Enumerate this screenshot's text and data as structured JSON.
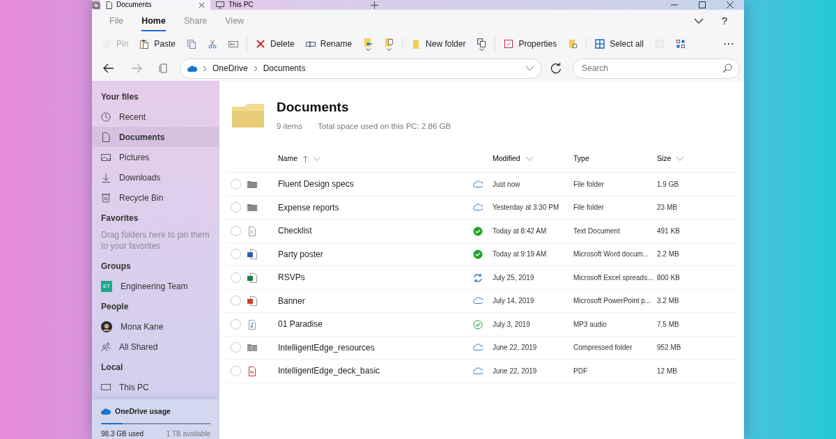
{
  "tabs": [
    {
      "label": "Documents",
      "selected": true,
      "closable": true
    },
    {
      "label": "This PC",
      "selected": false,
      "closable": false
    }
  ],
  "menu": [
    {
      "label": "File",
      "selected": false
    },
    {
      "label": "Home",
      "selected": true
    },
    {
      "label": "Share",
      "selected": false
    },
    {
      "label": "View",
      "selected": false
    }
  ],
  "toolbar": {
    "groups": [
      [
        {
          "label": "Pin",
          "disabled": true,
          "dropdown": false
        },
        {
          "label": "Paste",
          "disabled": false,
          "dropdown": false
        },
        {
          "disabled": false,
          "dropdown": false
        },
        {
          "disabled": false,
          "dropdown": false
        },
        {
          "disabled": false,
          "dropdown": false
        }
      ],
      [
        {
          "label": "Delete",
          "disabled": false,
          "dropdown": false
        },
        {
          "label": "Rename",
          "disabled": false,
          "dropdown": false
        },
        {
          "disabled": false,
          "dropdown": true
        },
        {
          "disabled": false,
          "dropdown": true
        }
      ],
      [
        {
          "label": "New folder",
          "disabled": false,
          "dropdown": false
        },
        {
          "disabled": false,
          "dropdown": true
        }
      ],
      [
        {
          "label": "Properties",
          "disabled": false,
          "dropdown": false
        },
        {
          "disabled": false,
          "dropdown": false
        }
      ],
      [
        {
          "label": "Select all",
          "disabled": false,
          "dropdown": false
        },
        {
          "disabled": true,
          "dropdown": false
        },
        {
          "disabled": false,
          "dropdown": false
        }
      ]
    ],
    "more": "⋯"
  },
  "help": "?",
  "address": {
    "breadcrumbs": [
      "OneDrive",
      "Documents"
    ],
    "search_placeholder": "Search"
  },
  "sidebar": {
    "sections": [
      {
        "title": "Your files",
        "items": [
          {
            "label": "Recent",
            "selected": false
          },
          {
            "label": "Documents",
            "selected": true
          },
          {
            "label": "Pictures",
            "selected": false
          },
          {
            "label": "Downloads",
            "selected": false
          },
          {
            "label": "Recycle Bin",
            "selected": false
          }
        ]
      },
      {
        "title": "Favorites",
        "hint": "Drag folders here to pin them to your favorites"
      },
      {
        "title": "Groups",
        "items": [
          {
            "label": "Engineering Team",
            "selected": false,
            "badge": "ET",
            "color": "#1aa88a"
          }
        ]
      },
      {
        "title": "People",
        "items": [
          {
            "label": "Mona Kane",
            "selected": false
          },
          {
            "label": "All Shared",
            "selected": false
          }
        ]
      },
      {
        "title": "Local",
        "items": [
          {
            "label": "This PC",
            "selected": false
          }
        ]
      }
    ],
    "usage": {
      "title": "OneDrive usage",
      "level": 0.2,
      "used": "98.3 GB used",
      "available": "1 TB available"
    }
  },
  "folder": {
    "title": "Documents",
    "count": "9 items",
    "space": "Total space used on this PC: 2.86 GB"
  },
  "table": {
    "columns": [
      {
        "label": "Name",
        "sorted": true
      },
      {
        "label": "Modified",
        "sorted": false
      },
      {
        "label": "Type",
        "sorted": false
      },
      {
        "label": "Size",
        "sorted": false
      }
    ],
    "rows": [
      {
        "name": "Fluent Design specs",
        "file_icon": {
          "kind": "folder"
        },
        "sync_status": {
          "kind": "cloud"
        },
        "modified": "Just now",
        "type": "File folder",
        "size": "1.9 GB",
        "selected": false
      },
      {
        "name": "Expense reports",
        "file_icon": {
          "kind": "folder"
        },
        "sync_status": {
          "kind": "cloud"
        },
        "modified": "Yesterday at 3:30 PM",
        "type": "File folder",
        "size": "23 MB",
        "selected": false
      },
      {
        "name": "Checklist",
        "file_icon": {
          "kind": "text"
        },
        "sync_status": {
          "kind": "synced"
        },
        "modified": "Today at 8:42 AM",
        "type": "Text Document",
        "size": "491 KB",
        "selected": false
      },
      {
        "name": "Party poster",
        "file_icon": {
          "kind": "word"
        },
        "sync_status": {
          "kind": "synced"
        },
        "modified": "Today at 9:19 AM",
        "type": "Microsoft Word docum...",
        "size": "2.2 MB",
        "selected": false
      },
      {
        "name": "RSVPs",
        "file_icon": {
          "kind": "excel"
        },
        "sync_status": {
          "kind": "syncing"
        },
        "modified": "July 25, 2019",
        "type": "Microsoft Excel spreads...",
        "size": "800 KB",
        "selected": false
      },
      {
        "name": "Banner",
        "file_icon": {
          "kind": "powerpoint"
        },
        "sync_status": {
          "kind": "cloud"
        },
        "modified": "July 14, 2019",
        "type": "Microsoft PowerPoint p...",
        "size": "3.2 MB",
        "selected": false
      },
      {
        "name": "01 Paradise",
        "file_icon": {
          "kind": "audio"
        },
        "sync_status": {
          "kind": "available"
        },
        "modified": "July 3, 2019",
        "type": "MP3 audio",
        "size": "7.5 MB",
        "selected": false
      },
      {
        "name": "IntelligentEdge_resources",
        "file_icon": {
          "kind": "zip"
        },
        "sync_status": {
          "kind": "cloud"
        },
        "modified": "June 22, 2019",
        "type": "Compressed folder",
        "size": "952 MB",
        "selected": false
      },
      {
        "name": "IntelligentEdge_deck_basic",
        "file_icon": {
          "kind": "pdf"
        },
        "sync_status": {
          "kind": "cloud"
        },
        "modified": "June 22, 2019",
        "type": "PDF",
        "size": "12 MB",
        "selected": false
      }
    ]
  }
}
